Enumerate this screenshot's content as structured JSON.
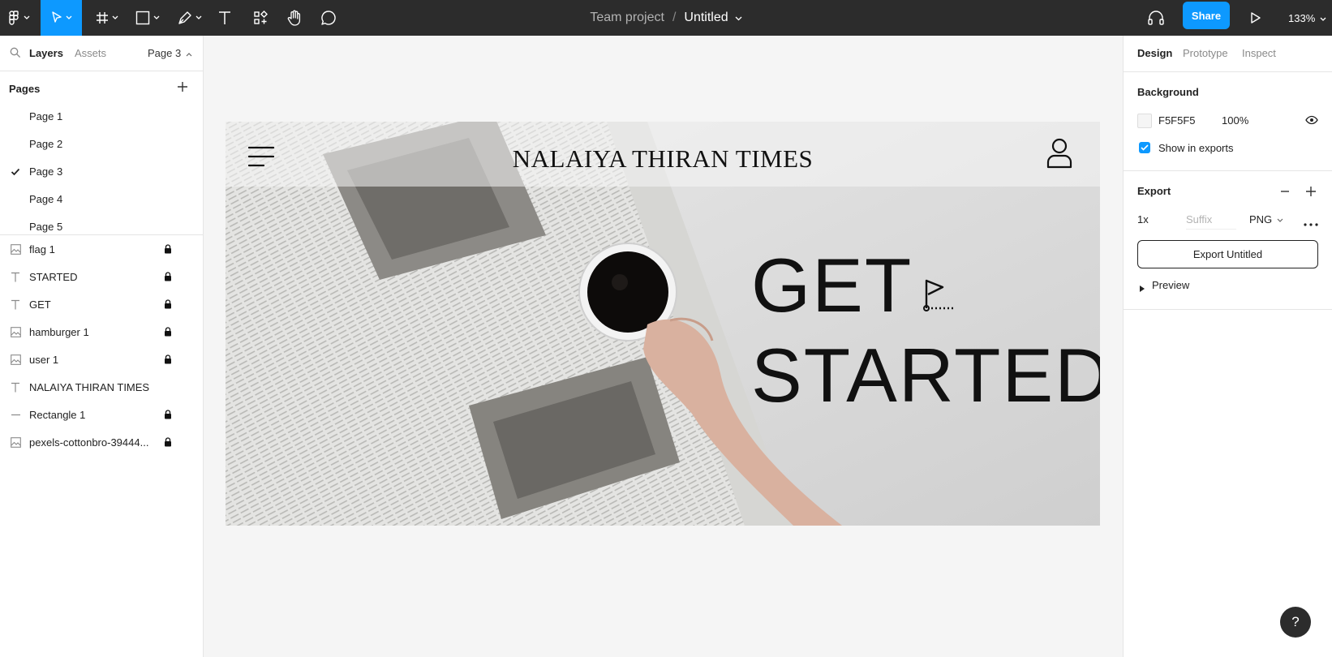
{
  "toolbar": {
    "title_team": "Team project",
    "title_separator": "/",
    "title_file": "Untitled",
    "share_label": "Share",
    "zoom_label": "133%",
    "accent_color": "#0d99ff",
    "icons": [
      "main-menu-icon",
      "move-tool-icon",
      "frame-tool-icon",
      "shape-tool-icon",
      "pen-tool-icon",
      "text-tool-icon",
      "resources-icon",
      "hand-tool-icon",
      "comment-icon",
      "headphones-icon",
      "present-icon"
    ]
  },
  "left_panel": {
    "tabs": [
      "Layers",
      "Assets"
    ],
    "current_page": "Page 3",
    "pages_heading": "Pages",
    "pages": [
      {
        "label": "Page 1",
        "selected": false
      },
      {
        "label": "Page 2",
        "selected": false
      },
      {
        "label": "Page 3",
        "selected": true
      },
      {
        "label": "Page 4",
        "selected": false
      },
      {
        "label": "Page 5",
        "selected": false
      }
    ],
    "layers": [
      {
        "label": "flag 1",
        "type": "image",
        "locked": true
      },
      {
        "label": "STARTED",
        "type": "text",
        "locked": true
      },
      {
        "label": "GET",
        "type": "text",
        "locked": true
      },
      {
        "label": "hamburger 1",
        "type": "image",
        "locked": true
      },
      {
        "label": "user 1",
        "type": "image",
        "locked": true
      },
      {
        "label": "NALAIYA THIRAN TIMES",
        "type": "text",
        "locked": false
      },
      {
        "label": "Rectangle 1",
        "type": "rectangle",
        "locked": true
      },
      {
        "label": "pexels-cottonbro-39444...",
        "type": "image",
        "locked": true
      }
    ]
  },
  "right_panel": {
    "tabs": [
      "Design",
      "Prototype",
      "Inspect"
    ],
    "background_heading": "Background",
    "background_color": "F5F5F5",
    "background_opacity": "100%",
    "show_in_exports_label": "Show in exports",
    "show_in_exports_checked": true,
    "export_heading": "Export",
    "export_scale": "1x",
    "export_suffix_placeholder": "Suffix",
    "export_format": "PNG",
    "export_button_label": "Export Untitled",
    "preview_label": "Preview"
  },
  "canvas": {
    "brand_title": "NALAIYA THIRAN TIMES",
    "hero_line1": "GET",
    "hero_line2": "STARTED",
    "canvas_bg_color": "#f5f5f5"
  },
  "help_label": "?"
}
